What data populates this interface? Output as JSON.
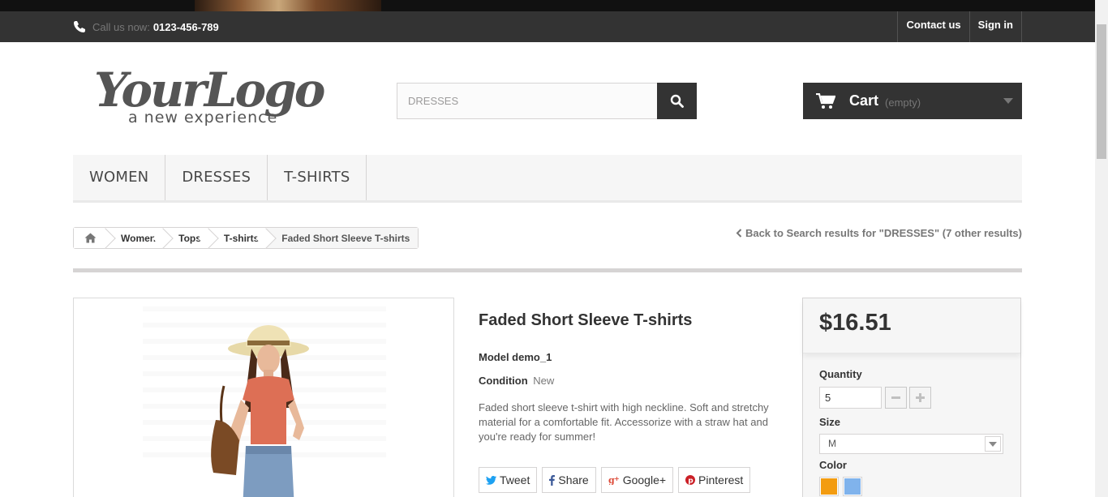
{
  "topbar": {
    "call_prefix": "Call us now:",
    "phone": "0123-456-789",
    "links": [
      "Contact us",
      "Sign in"
    ]
  },
  "header": {
    "logo_main": "YourLogo",
    "logo_tagline": "a new experience",
    "search_value": "DRESSES",
    "cart_label": "Cart",
    "cart_status": "(empty)"
  },
  "menu": [
    "WOMEN",
    "DRESSES",
    "T-SHIRTS"
  ],
  "breadcrumb": [
    "Women",
    "Tops",
    "T-shirts",
    "Faded Short Sleeve T-shirts"
  ],
  "back_link": "Back to Search results for \"DRESSES\" (7 other results)",
  "product": {
    "title": "Faded Short Sleeve T-shirts",
    "model": "Model demo_1",
    "condition_label": "Condition",
    "condition_value": "New",
    "description": "Faded short sleeve t-shirt with high neckline. Soft and stretchy material for a comfortable fit. Accessorize with a straw hat and you're ready for summer!"
  },
  "share": [
    "Tweet",
    "Share",
    "Google+",
    "Pinterest"
  ],
  "buy": {
    "price": "$16.51",
    "quantity_label": "Quantity",
    "quantity_value": "5",
    "size_label": "Size",
    "size_value": "M",
    "color_label": "Color",
    "colors": [
      "#f39c11",
      "#80b3ec"
    ]
  },
  "colors": {
    "dark": "#333333",
    "accent_twitter": "#1da1f2",
    "accent_pinterest": "#cb2027",
    "accent_google": "#dd4b39"
  }
}
